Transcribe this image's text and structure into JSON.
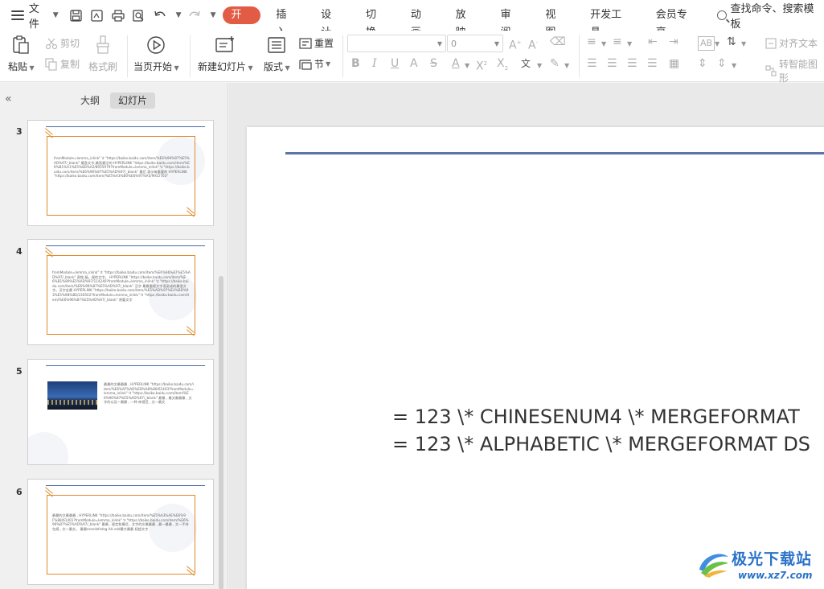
{
  "menubar": {
    "file_label": "文件",
    "tabs": [
      "开始",
      "插入",
      "设计",
      "切换",
      "动画",
      "放映",
      "审阅",
      "视图",
      "开发工具",
      "会员专享"
    ],
    "active_tab": "开始",
    "search_label": "查找命令、搜索模板"
  },
  "ribbon": {
    "paste": "粘贴",
    "cut": "剪切",
    "copy": "复制",
    "format_painter": "格式刷",
    "from_current": "当页开始",
    "new_slide": "新建幻灯片",
    "layout": "版式",
    "reset": "重置",
    "section": "节",
    "font_size_value": "0",
    "font_name_value": "",
    "align_text": "对齐文本",
    "smart_graphic": "转智能图形"
  },
  "left_panel": {
    "tab_outline": "大纲",
    "tab_slides": "幻灯片",
    "active_tab": "幻灯片",
    "slides": [
      {
        "num": "3",
        "text": "fromModule=lemma_inlink\" \\t \"https://baike.baidu.com/item/%E6%96%87%E5%AD%97/_blank\" 最直文字,最直最注的 HYPERLINK \"https://baike.baidu.com/item/%E6%B1%A1%E5%8D%A2/8955979?fromModule=lemma_inlink\" \\t \"https://baike.baidu.com/item/%E6%96%87%E5%AD%97/_blank\" 最后 表示每重要的 HYPERLINK \"https://baike.baidu.com/item/%E5%A3%B0%E6%97%A5/9932703\""
      },
      {
        "num": "4",
        "text": "fromModule=lemma_inlink\" \\t \"https://baike.baidu.com/item/%E6%96%87%E5%AD%97/_blank\" 表惟 级。规的文字。 HYPERLINK \"https://baike.baidu.com/item/%E6%B1%89%E5%AD%97/114240?fromModule=lemma_inlink\" \\t \"https://baike.baidu.com/item/%E6%96%87%E5%AD%97/_blank\" 汉字 最最重视文字语说成的最很文字。汉字金最 HYPERLINK \"https://baike.baidu.com/item/%E5%AD%97%E4%BD%93%E5%9B%BE/230502?fromModule=lemma_inlink\" \\t \"https://baike.baidu.com/item/%E6%96%87%E5%AD%97/_blank\" 原要文字"
      },
      {
        "num": "5",
        "text": "最最的文最最最 , HYPERLINK \"https://baike.baidu.com/item/%E6%AF%AD%E8%A8%80/61403?fromModule=lemma_inlink\" \\t \"https://baike.baidu.com/item/%E6%96%87%E5%AD%97/_blank\" 最最 , 最文最最最 , 文字的以及一最最 , 一种 库规范 , 文一最文"
      },
      {
        "num": "6",
        "text": "最最的文最最最 , HYPERLINK \"https://baike.baidu.com/item/%E5%A3%AE%E6%9F%88/61401?fromModule=lemma_inlink\" \\t \"https://baike.baidu.com/item/%E6%96%87%E5%AD%97/_blank\" 最最 , 规定和最话 , 文字的文最最最 , 最一最最 , 文一手终包规 , 文一最文。 最最mendsfsdsg AH sdd最大最最 权超文字"
      }
    ]
  },
  "slide": {
    "line1": "= 123 \\* CHINESENUM4 \\* MERGEFORMAT",
    "line2": "= 123 \\* ALPHABETIC \\* MERGEFORMAT DS"
  },
  "watermark": {
    "title": "极光下载站",
    "url": "www.xz7.com"
  }
}
